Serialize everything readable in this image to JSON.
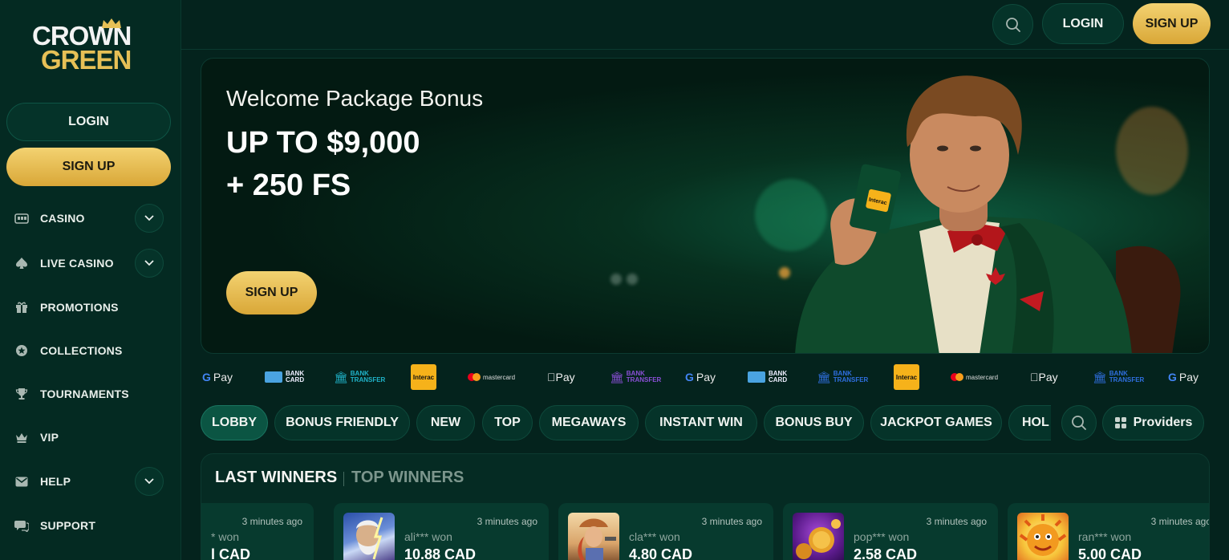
{
  "brand": {
    "line1": "CROWN",
    "line2": "GREEN"
  },
  "sidebar": {
    "login_label": "LOGIN",
    "signup_label": "SIGN UP",
    "items": [
      {
        "label": "CASINO",
        "icon": "slot-machine-icon",
        "expandable": true
      },
      {
        "label": "LIVE CASINO",
        "icon": "spade-icon",
        "expandable": true
      },
      {
        "label": "PROMOTIONS",
        "icon": "gift-icon",
        "expandable": false
      },
      {
        "label": "COLLECTIONS",
        "icon": "star-circle-icon",
        "expandable": false
      },
      {
        "label": "TOURNAMENTS",
        "icon": "trophy-icon",
        "expandable": false
      },
      {
        "label": "VIP",
        "icon": "crown-icon",
        "expandable": false
      },
      {
        "label": "HELP",
        "icon": "mail-icon",
        "expandable": true
      },
      {
        "label": "SUPPORT",
        "icon": "chat-icon",
        "expandable": false
      }
    ]
  },
  "header": {
    "login_label": "LOGIN",
    "signup_label": "SIGN UP"
  },
  "hero": {
    "title": "Welcome Package Bonus",
    "amount": "UP TO $9,000",
    "freespins": "+ 250 FS",
    "signup_label": "SIGN UP",
    "card_text": "Interac"
  },
  "payments": [
    {
      "type": "gpay",
      "g": "G",
      "text": "Pay"
    },
    {
      "type": "bankcard",
      "text1": "BANK",
      "text2": "CARD"
    },
    {
      "type": "banktransfer",
      "text1": "BANK",
      "text2": "TRANSFER",
      "color": "#20b3c9"
    },
    {
      "type": "interac",
      "text": "Interac"
    },
    {
      "type": "mastercard",
      "text": "mastercard"
    },
    {
      "type": "applepay",
      "text": "Pay"
    },
    {
      "type": "banktransfer",
      "text1": "BANK",
      "text2": "TRANSFER",
      "color": "#8a4fd6"
    },
    {
      "type": "gpay",
      "g": "G",
      "text": "Pay"
    },
    {
      "type": "bankcard",
      "text1": "BANK",
      "text2": "CARD"
    },
    {
      "type": "banktransfer",
      "text1": "BANK",
      "text2": "TRANSFER",
      "color": "#2f6fe0"
    },
    {
      "type": "interac",
      "text": "Interac"
    },
    {
      "type": "mastercard",
      "text": "mastercard"
    },
    {
      "type": "applepay",
      "text": "Pay"
    },
    {
      "type": "banktransfer",
      "text1": "BANK",
      "text2": "TRANSFER",
      "color": "#2f6fe0"
    },
    {
      "type": "gpay",
      "g": "G",
      "text": "Pay"
    }
  ],
  "tabs": [
    "LOBBY",
    "BONUS FRIENDLY",
    "NEW",
    "TOP",
    "MEGAWAYS",
    "INSTANT WIN",
    "BONUS BUY",
    "JACKPOT GAMES",
    "HOL"
  ],
  "active_tab": "LOBBY",
  "providers_label": "Providers",
  "winners": {
    "last_label": "LAST WINNERS",
    "top_label": "TOP WINNERS",
    "items": [
      {
        "time": "3 minutes ago",
        "user": "* won",
        "amount": "l CAD"
      },
      {
        "time": "3 minutes ago",
        "user": "ali*** won",
        "amount": "10.88 CAD"
      },
      {
        "time": "3 minutes ago",
        "user": "cla*** won",
        "amount": "4.80 CAD"
      },
      {
        "time": "3 minutes ago",
        "user": "pop*** won",
        "amount": "2.58 CAD"
      },
      {
        "time": "3 minutes ago",
        "user": "ran*** won",
        "amount": "5.00 CAD"
      }
    ]
  },
  "colors": {
    "bg": "#04231d",
    "panel": "#053329",
    "gold": "#e6c056",
    "accent_green": "#0b5543"
  }
}
